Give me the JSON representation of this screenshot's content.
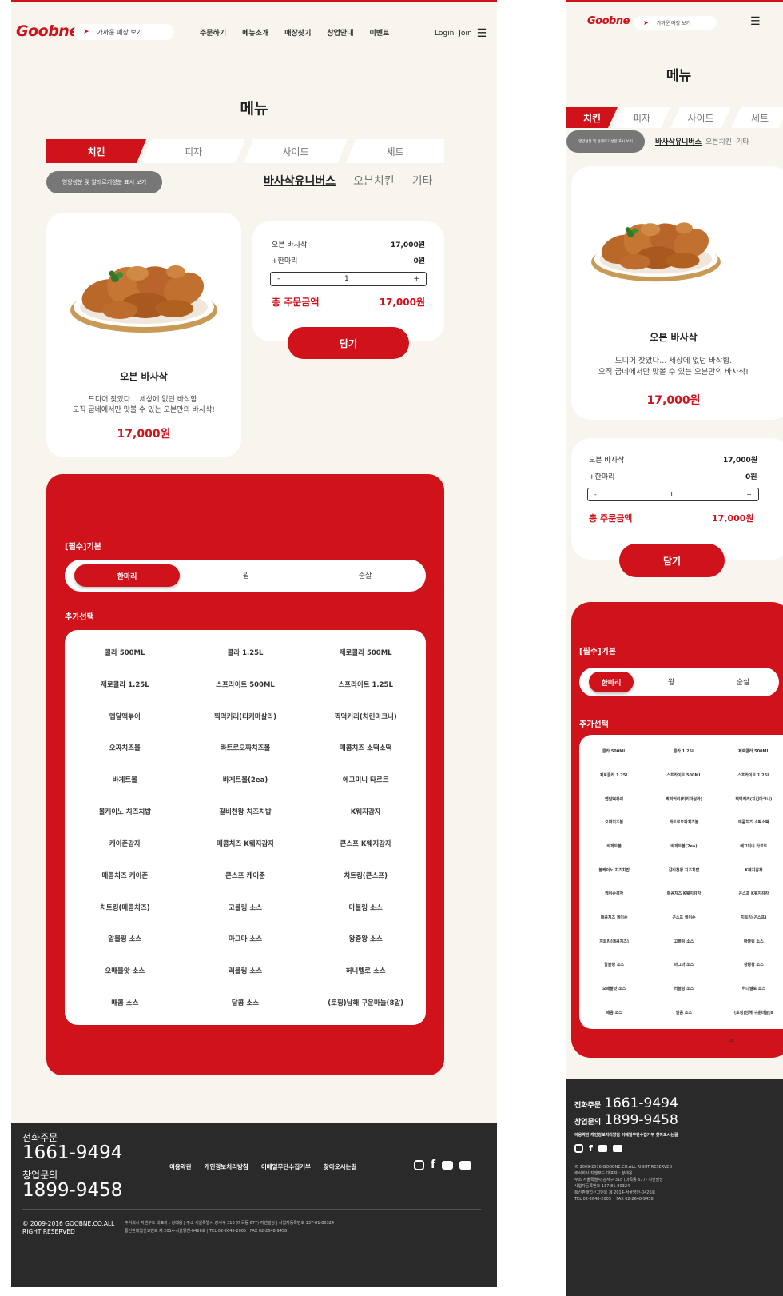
{
  "header": {
    "logo": "Goobne",
    "store_search": "가까운 매장 보기",
    "nav": [
      "주문하기",
      "메뉴소개",
      "매장찾기",
      "창업안내",
      "이벤트"
    ],
    "login": "Login",
    "join": "Join"
  },
  "page_title": "메뉴",
  "tabs": [
    "치킨",
    "피자",
    "사이드",
    "세트"
  ],
  "nutrition_button": "영양성분 및 알레르기성분 표시 보기",
  "subcats": [
    "바사삭유니버스",
    "오븐치킨",
    "기타"
  ],
  "product": {
    "name": "오븐 바사삭",
    "desc1": "드디어 찾았다... 세상에 없던 바삭함.",
    "desc2": "오직 굽네에서만 맛볼 수 있는 오븐만의 바사삭!",
    "price": "17,000원"
  },
  "order": {
    "item_label": "오븐 바사삭",
    "item_price": "17,000원",
    "extra_label": "+한마리",
    "extra_price": "0원",
    "minus": "-",
    "qty": "1",
    "plus": "+",
    "total_label": "총 주문금액",
    "total_price": "17,000원",
    "add_button": "담기"
  },
  "options": {
    "required_title": "[필수]기본",
    "required": [
      "한마리",
      "윙",
      "순살"
    ],
    "extra_title": "추가선택",
    "items": [
      "콜라 500ML",
      "콜라 1.25L",
      "제로콜라 500ML",
      "제로콜라 1.25L",
      "스프라이트 500ML",
      "스프라이트 1.25L",
      "맵달떡볶이",
      "찍먹커리(티키마살라)",
      "찍먹커리(치킨마크니)",
      "오짜치즈볼",
      "콰트로오짜치즈볼",
      "매콤치즈 소떡소떡",
      "바게트볼",
      "바게트볼(2ea)",
      "에그미니 타르트",
      "볼케이노 치즈치밥",
      "갈비천왕 치즈치밥",
      "K웨지감자",
      "케이준감자",
      "매콤치즈 K웨지감자",
      "콘스프 K웨지감자",
      "매콤치즈 케이준",
      "콘스프 케이준",
      "치트킹(콘스프)",
      "치트킹(매콤치즈)",
      "고블링 소스",
      "마블링 소스",
      "알블링 소스",
      "마그마 소스",
      "왕중왕 소스",
      "오매불앗 소스",
      "러블링 소스",
      "허니멜로 소스",
      "매콤 소스",
      "달콤 소스",
      "(토핑)남해 구운마늘(8알)"
    ],
    "mobile_last": "(토핑)남해 구운마늘(8"
  },
  "mobile_scroll_text": "10",
  "footer": {
    "tel_label": "전화주문",
    "tel": "1661-9494",
    "franchise_label": "창업문의",
    "franchise": "1899-9458",
    "links": [
      "이용약관",
      "개인정보처리방침",
      "이메일무단수집거부",
      "찾아오시는길"
    ],
    "copyright1": "© 2009-2016 GOOBNE.CO.ALL",
    "copyright2": "RIGHT RESERVED",
    "company1": "주식회사 지앤푸드 대표자 : 정태용 | 주소 서울특별시 강서구 318 (마곡동 677) 지앤빌딩 | 사업자등록번호 137-81-80324 |",
    "company2": "통신판매업신고번호 제 2014-서울양천-0426호 | TEL 02-2648-2005 | FAX 02-2648-9458",
    "m_copyright": "© 2009-2016 GOOBNE.CO.ALL RIGHT RESERVED",
    "m_lines": [
      "주식회사 지앤푸드 대표자 : 정태용",
      "주소 서울특별시 강서구 318 (마곡동 677) 지앤빌딩",
      "사업자등록번호 137-81-80324",
      "통신판매업신고번호 제 2014-서울양천-0426호",
      "TEL 02-2648-2005    FAX 02-2648-9458"
    ],
    "m_links": "이용약관 개인정보처리방침 이메일무단수집거부 찾아오시는길"
  },
  "colors": {
    "accent": "#d0121b",
    "bg": "#f8f4ee",
    "footer": "#2a2a2a",
    "tab_nut": "#777777"
  }
}
